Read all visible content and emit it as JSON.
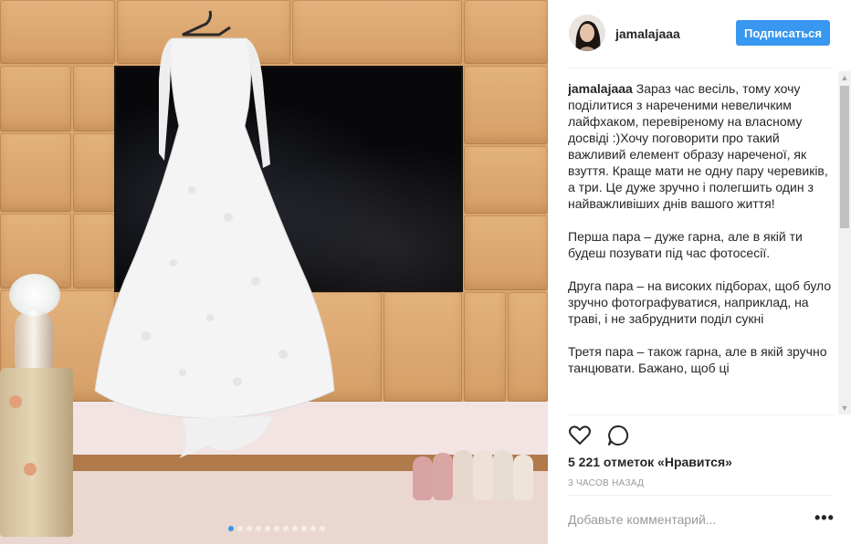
{
  "post": {
    "username": "jamalajaaa",
    "follow_label": "Подписаться",
    "caption_author": "jamalajaaa",
    "caption_paragraphs": [
      "Зараз час весіль, тому хочу поділитися з нареченими невеличким лайфхаком, перевіреному на власному досвіді :)Хочу поговорити про такий важливий елемент образу нареченої, як взуття. Краще мати не одну пару черевиків, а три. Це дуже зручно і полегшить один з найважливіших днів вашого життя!",
      "Перша пара – дуже гарна, але в якій ти будеш позувати під час фотосесії.",
      "Друга пара – на високих підборах, щоб було зручно фотографуватися, наприклад, на траві, і не забруднити поділ сукні",
      "Третя пара – також гарна, але в якій зручно танцювати. Бажано, щоб ці"
    ],
    "likes_text": "5 221 отметок «Нравится»",
    "time_text": "3 ЧАСОВ НАЗАД",
    "comment_placeholder": "Добавьте комментарий...",
    "more_label": "•••"
  },
  "carousel": {
    "dot_count": 11,
    "active_index": 0
  },
  "icons": {
    "like": "heart-icon",
    "comment": "comment-icon",
    "scroll_up": "chevron-up-icon",
    "scroll_down": "chevron-down-icon"
  },
  "colors": {
    "accent": "#3897f0",
    "text": "#262626",
    "muted": "#999999"
  }
}
